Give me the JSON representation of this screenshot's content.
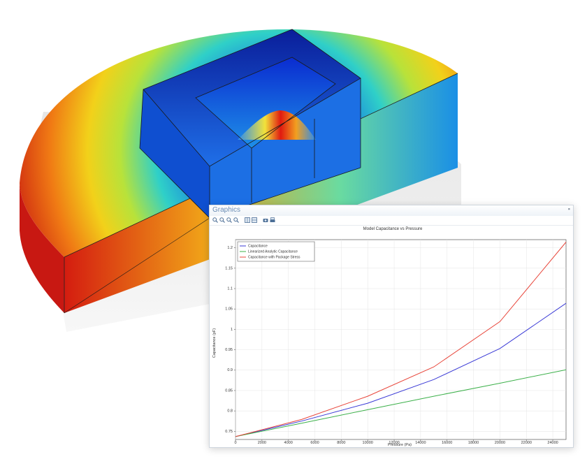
{
  "window": {
    "title": "Graphics"
  },
  "toolbar": {
    "buttons": [
      "zoom-in-icon",
      "zoom-out-icon",
      "zoom-box-icon",
      "zoom-extents-icon",
      "table-icon",
      "grid-icon",
      "camera-icon",
      "print-icon"
    ]
  },
  "colors": {
    "capacitance": "#3a3ad6",
    "analytic": "#3cb04a",
    "stress": "#e8453a"
  },
  "chart_data": {
    "type": "line",
    "title": "Model Capacitance vs Pressure",
    "xlabel": "Pressure (Pa)",
    "ylabel": "Capacitance (pF)",
    "xlim": [
      0,
      25000
    ],
    "ylim": [
      0.73,
      1.22
    ],
    "xticks": [
      0,
      2000,
      4000,
      6000,
      8000,
      10000,
      12000,
      14000,
      16000,
      18000,
      20000,
      22000,
      24000
    ],
    "yticks": [
      0.75,
      0.8,
      0.85,
      0.9,
      0.95,
      1,
      1.05,
      1.1,
      1.15,
      1.2
    ],
    "ytick_labels": [
      "0.75",
      "0.8",
      "0.85",
      "0.9",
      "0.95",
      "1",
      "1.05",
      "1.1",
      "1.15",
      "1.2"
    ],
    "grid": true,
    "legend_position": "top-left",
    "series": [
      {
        "name": "Capacitance",
        "x": [
          0,
          5000,
          10000,
          15000,
          20000,
          25000
        ],
        "values": [
          0.737,
          0.775,
          0.819,
          0.877,
          0.953,
          1.064
        ]
      },
      {
        "name": "Linearized Analytic Capacitance",
        "x": [
          0,
          5000,
          10000,
          15000,
          20000,
          25000
        ],
        "values": [
          0.737,
          0.77,
          0.803,
          0.836,
          0.868,
          0.901
        ]
      },
      {
        "name": "Capacitance with Package Stress",
        "x": [
          0,
          5000,
          10000,
          15000,
          20000,
          25000
        ],
        "values": [
          0.737,
          0.779,
          0.836,
          0.908,
          1.019,
          1.214
        ]
      }
    ]
  }
}
